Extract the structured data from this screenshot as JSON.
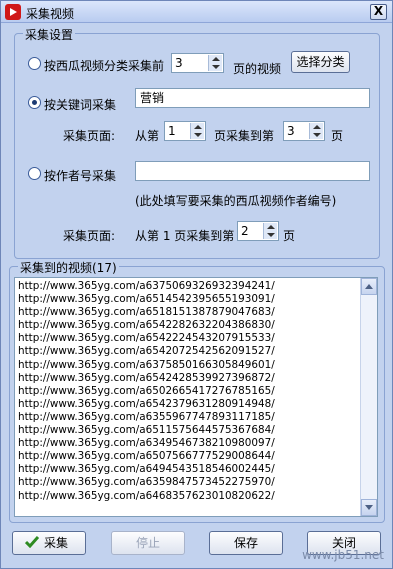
{
  "window": {
    "title": "采集视频",
    "close_label": "X"
  },
  "settings": {
    "legend": "采集设置",
    "category_option": {
      "label": "按西瓜视频分类采集前",
      "pages_value": "3",
      "suffix": "页的视频",
      "select_button": "选择分类",
      "checked": false
    },
    "keyword_option": {
      "label": "按关键词采集",
      "keyword_value": "营销",
      "checked": true,
      "pages_label": "采集页面:",
      "from_label": "从第",
      "from_value": "1",
      "to_label": "页采集到第",
      "to_value": "3",
      "page_suffix": "页"
    },
    "author_option": {
      "label": "按作者号采集",
      "author_value": "",
      "checked": false,
      "hint": "(此处填写要采集的西瓜视频作者编号)",
      "pages_label": "采集页面:",
      "from_text": "从第 1 页采集到第",
      "to_value": "2",
      "page_suffix": "页"
    }
  },
  "results": {
    "legend": "采集到的视频(17)",
    "urls": [
      "http://www.365yg.com/a6375069326932394241/",
      "http://www.365yg.com/a6514542395655193091/",
      "http://www.365yg.com/a6518151387879047683/",
      "http://www.365yg.com/a6542282632204386830/",
      "http://www.365yg.com/a6542224543207915533/",
      "http://www.365yg.com/a6542072542562091527/",
      "http://www.365yg.com/a6375850166305849601/",
      "http://www.365yg.com/a6542428539927396872/",
      "http://www.365yg.com/a6502665417276785165/",
      "http://www.365yg.com/a6542379631280914948/",
      "http://www.365yg.com/a6355967747893117185/",
      "http://www.365yg.com/a6511575644575367684/",
      "http://www.365yg.com/a6349546738210980097/",
      "http://www.365yg.com/a6507566777529008644/",
      "http://www.365yg.com/a6494543518546002445/",
      "http://www.365yg.com/a6359847573452275970/",
      "http://www.365yg.com/a6468357623010820622/"
    ]
  },
  "buttons": {
    "collect": "采集",
    "stop": "停止",
    "save": "保存",
    "close": "关闭"
  },
  "watermark": "www.jb51.net",
  "colors": {
    "window_bg": "#c2d2ee",
    "check_green": "#2e8b22",
    "app_icon_red": "#d01818"
  }
}
